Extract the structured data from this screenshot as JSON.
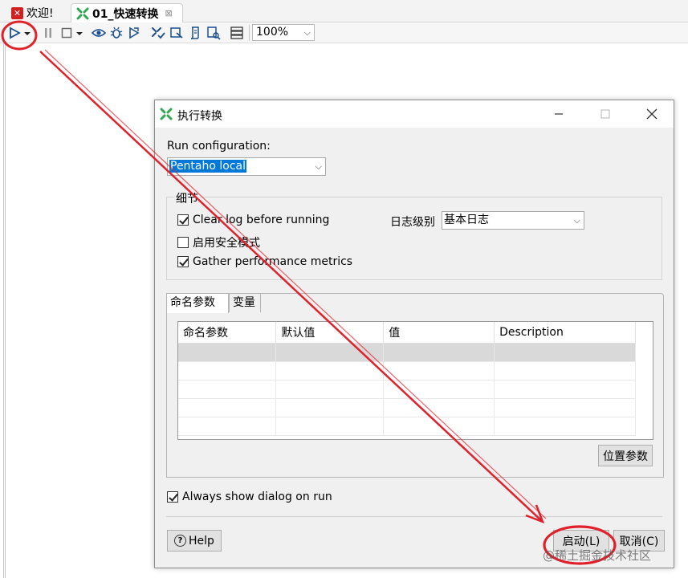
{
  "tabs": {
    "welcome_label": "欢迎!",
    "active_label": "01_快速转换",
    "close_glyph": "⊠"
  },
  "toolbar": {
    "zoom_value": "100%",
    "dropdown_glyph": "⌵"
  },
  "dialog": {
    "title": "执行转换",
    "run_config_label": "Run configuration:",
    "run_config_value": "Pentaho local",
    "details_group": "细节",
    "clear_log": "Clear log before running",
    "safe_mode": "启用安全模式",
    "gather_metrics": "Gather performance metrics",
    "log_level_label": "日志级别",
    "log_level_value": "基本日志",
    "tab_named_params": "命名参数",
    "tab_variables": "变量",
    "columns": [
      "命名参数",
      "默认值",
      "值",
      "Description"
    ],
    "position_params_button": "位置参数",
    "always_show": "Always show dialog on run",
    "help_button": "Help",
    "start_button": "启动(L)",
    "cancel_button": "取消(C)"
  },
  "watermark": "@稀土掘金技术社区",
  "colors": {
    "annotation_red": "#e0202a",
    "selection_blue": "#0078d7",
    "trans_icon_green": "#2fa84f"
  }
}
